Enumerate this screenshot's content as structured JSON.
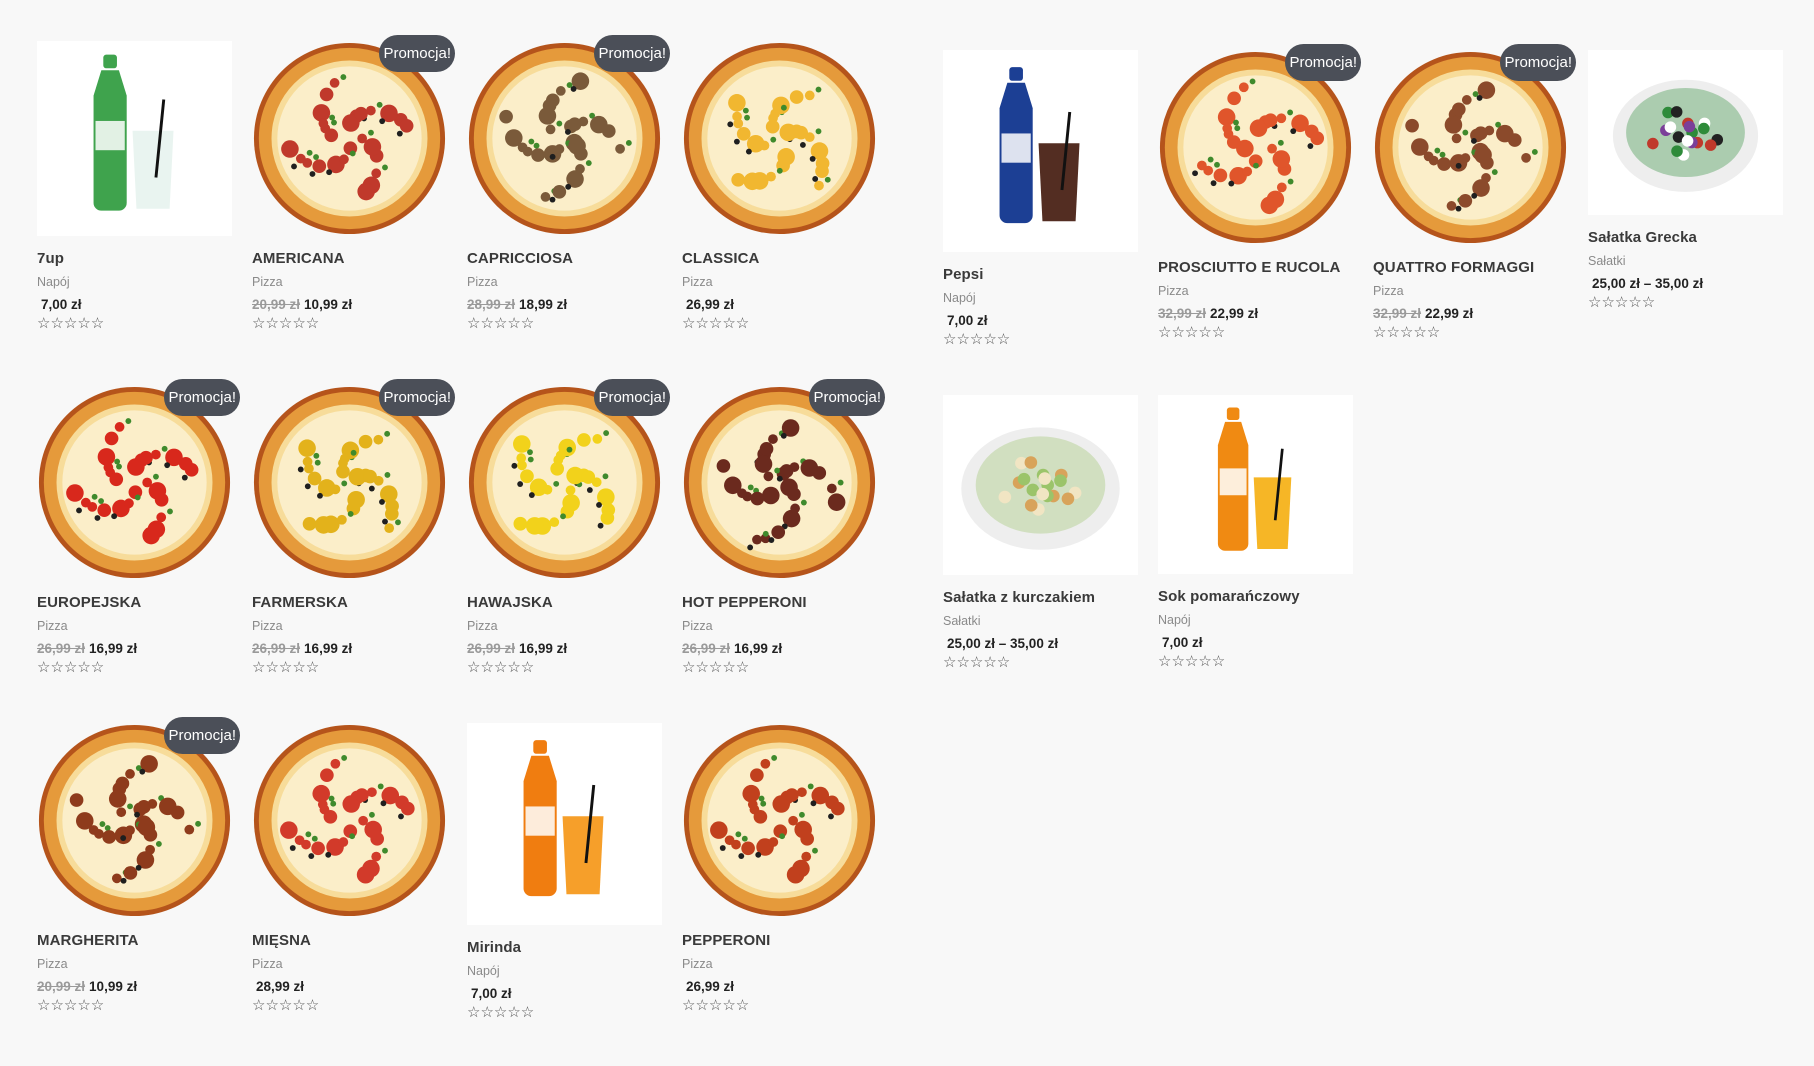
{
  "badge_label": "Promocja!",
  "stars_glyph": "☆☆☆☆☆",
  "products": [
    {
      "title": "7up",
      "category": "Napój",
      "old_price": "",
      "price": "7,00 zł",
      "promo": false,
      "image": "soda-bottle-7up",
      "bottle_color": "#3fa34d",
      "glass_color": "#e8f3ef"
    },
    {
      "title": "AMERICANA",
      "category": "Pizza",
      "old_price": "20,99 zł",
      "price": "10,99 zł",
      "promo": true,
      "image": "pizza",
      "topping_color": "#c0392b"
    },
    {
      "title": "CAPRICCIOSA",
      "category": "Pizza",
      "old_price": "28,99 zł",
      "price": "18,99 zł",
      "promo": true,
      "image": "pizza",
      "topping_color": "#7a5a3a"
    },
    {
      "title": "CLASSICA",
      "category": "Pizza",
      "old_price": "",
      "price": "26,99 zł",
      "promo": false,
      "image": "pizza",
      "topping_color": "#f1b730"
    },
    {
      "title": "Pepsi",
      "category": "Napój",
      "old_price": "",
      "price": "7,00 zł",
      "promo": false,
      "image": "soda-bottle-pepsi",
      "bottle_color": "#1c3f94",
      "glass_color": "#4a2216"
    },
    {
      "title": "PROSCIUTTO E RUCOLA",
      "category": "Pizza",
      "old_price": "32,99 zł",
      "price": "22,99 zł",
      "promo": true,
      "image": "pizza",
      "topping_color": "#e0552b"
    },
    {
      "title": "QUATTRO FORMAGGI",
      "category": "Pizza",
      "old_price": "32,99 zł",
      "price": "22,99 zł",
      "promo": true,
      "image": "pizza",
      "topping_color": "#8b4a2b"
    },
    {
      "title": "Sałatka Grecka",
      "category": "Sałatki",
      "old_price": "",
      "price": "25,00 zł – 35,00 zł",
      "promo": false,
      "image": "salad-greek"
    },
    {
      "title": "EUROPEJSKA",
      "category": "Pizza",
      "old_price": "26,99 zł",
      "price": "16,99 zł",
      "promo": true,
      "image": "pizza",
      "topping_color": "#d8281c"
    },
    {
      "title": "FARMERSKA",
      "category": "Pizza",
      "old_price": "26,99 zł",
      "price": "16,99 zł",
      "promo": true,
      "image": "pizza",
      "topping_color": "#e3b21b"
    },
    {
      "title": "HAWAJSKA",
      "category": "Pizza",
      "old_price": "26,99 zł",
      "price": "16,99 zł",
      "promo": true,
      "image": "pizza",
      "topping_color": "#f2d21b"
    },
    {
      "title": "HOT PEPPERONI",
      "category": "Pizza",
      "old_price": "26,99 zł",
      "price": "16,99 zł",
      "promo": true,
      "image": "pizza",
      "topping_color": "#6b2a1e"
    },
    {
      "title": "Sałatka z kurczakiem",
      "category": "Sałatki",
      "old_price": "",
      "price": "25,00 zł – 35,00 zł",
      "promo": false,
      "image": "salad-chicken"
    },
    {
      "title": "Sok pomarańczowy",
      "category": "Napój",
      "old_price": "",
      "price": "7,00 zł",
      "promo": false,
      "image": "juice-bottle",
      "bottle_color": "#f08a12",
      "glass_color": "#f6b21a"
    },
    {
      "title": "MARGHERITA",
      "category": "Pizza",
      "old_price": "20,99 zł",
      "price": "10,99 zł",
      "promo": true,
      "image": "pizza",
      "topping_color": "#8e3b1c"
    },
    {
      "title": "MIĘSNA",
      "category": "Pizza",
      "old_price": "",
      "price": "28,99 zł",
      "promo": false,
      "image": "pizza",
      "topping_color": "#d23a2a"
    },
    {
      "title": "Mirinda",
      "category": "Napój",
      "old_price": "",
      "price": "7,00 zł",
      "promo": false,
      "image": "soda-bottle-mirinda",
      "bottle_color": "#f07d10",
      "glass_color": "#f59a1f"
    },
    {
      "title": "PEPPERONI",
      "category": "Pizza",
      "old_price": "",
      "price": "26,99 zł",
      "promo": false,
      "image": "pizza",
      "topping_color": "#c1401d"
    }
  ]
}
